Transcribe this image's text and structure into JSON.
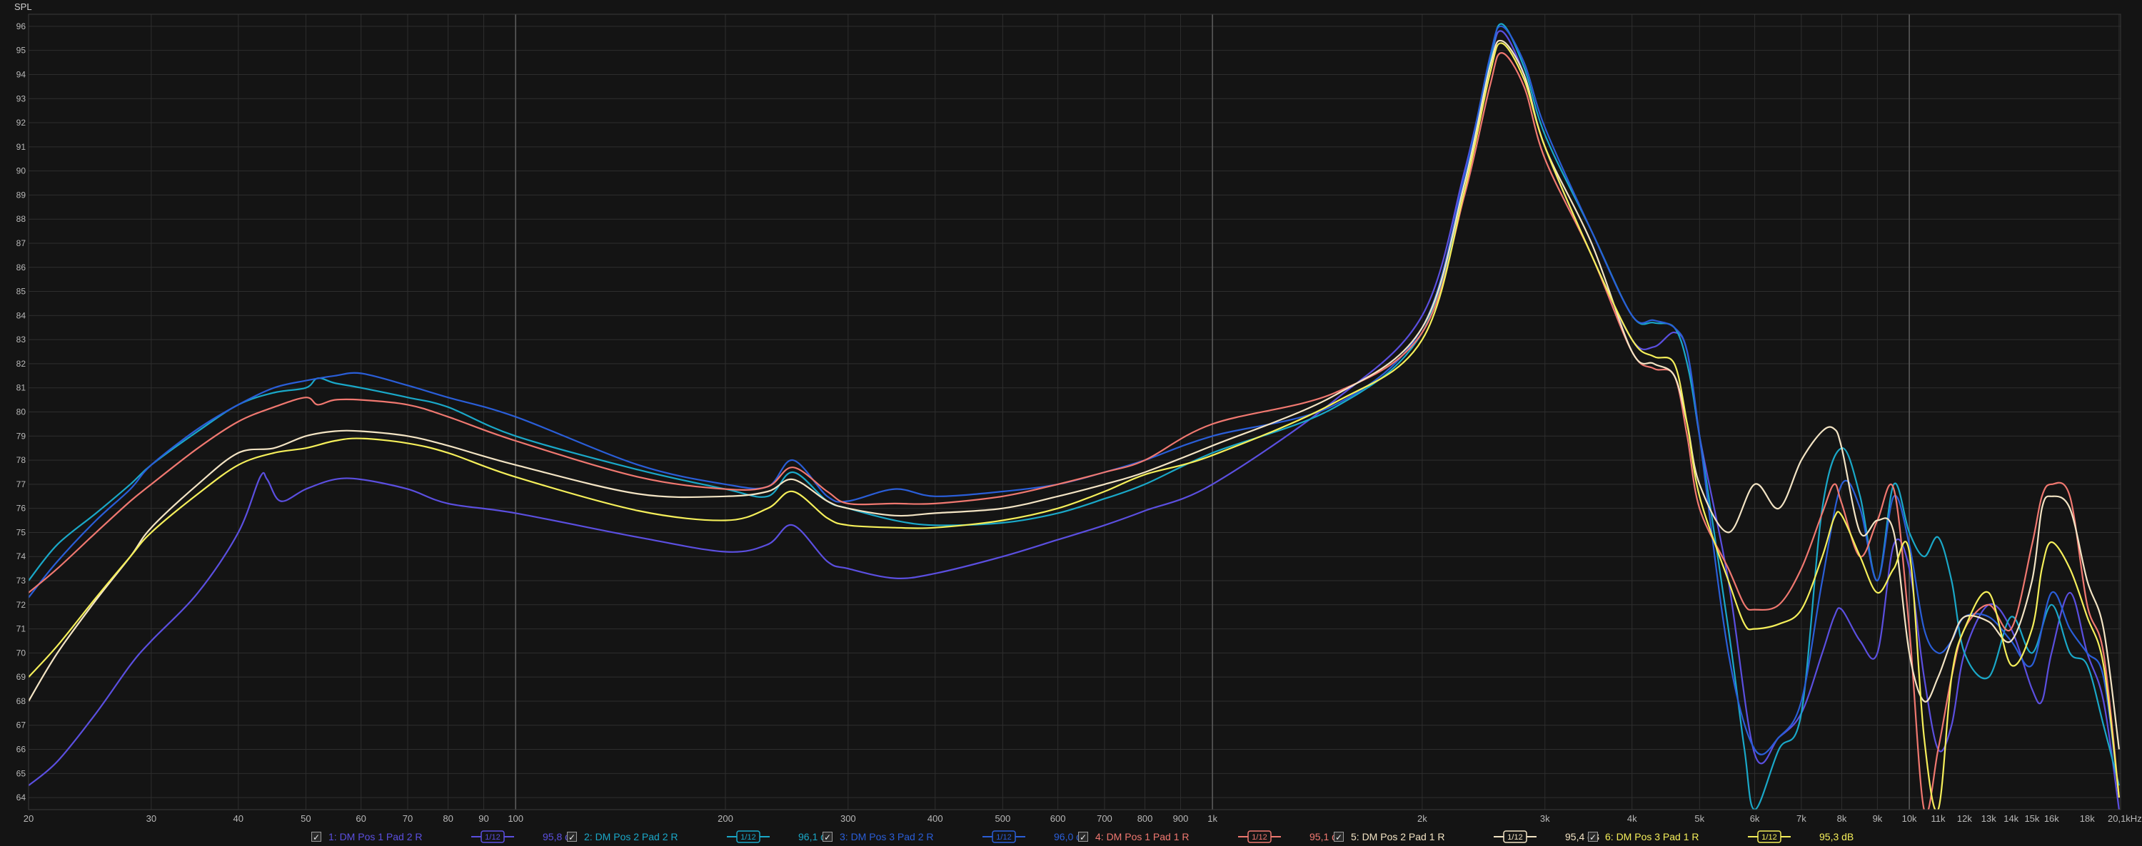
{
  "chart_data": {
    "type": "line",
    "ylabel": "SPL",
    "xlabel": "",
    "x_scale": "log",
    "xlim": [
      20,
      20100
    ],
    "ylim": [
      63.5,
      96.5
    ],
    "grid": true,
    "x_ticks": [
      {
        "v": 20,
        "t": "20"
      },
      {
        "v": 30,
        "t": "30"
      },
      {
        "v": 40,
        "t": "40"
      },
      {
        "v": 50,
        "t": "50"
      },
      {
        "v": 60,
        "t": "60"
      },
      {
        "v": 70,
        "t": "70"
      },
      {
        "v": 80,
        "t": "80"
      },
      {
        "v": 90,
        "t": "90"
      },
      {
        "v": 100,
        "t": "100"
      },
      {
        "v": 200,
        "t": "200"
      },
      {
        "v": 300,
        "t": "300"
      },
      {
        "v": 400,
        "t": "400"
      },
      {
        "v": 500,
        "t": "500"
      },
      {
        "v": 600,
        "t": "600"
      },
      {
        "v": 700,
        "t": "700"
      },
      {
        "v": 800,
        "t": "800"
      },
      {
        "v": 900,
        "t": "900"
      },
      {
        "v": 1000,
        "t": "1k"
      },
      {
        "v": 2000,
        "t": "2k"
      },
      {
        "v": 3000,
        "t": "3k"
      },
      {
        "v": 4000,
        "t": "4k"
      },
      {
        "v": 5000,
        "t": "5k"
      },
      {
        "v": 6000,
        "t": "6k"
      },
      {
        "v": 7000,
        "t": "7k"
      },
      {
        "v": 8000,
        "t": "8k"
      },
      {
        "v": 9000,
        "t": "9k"
      },
      {
        "v": 10000,
        "t": "10k"
      },
      {
        "v": 11000,
        "t": "11k"
      },
      {
        "v": 12000,
        "t": "12k"
      },
      {
        "v": 13000,
        "t": "13k"
      },
      {
        "v": 14000,
        "t": "14k"
      },
      {
        "v": 15000,
        "t": "15k"
      },
      {
        "v": 16000,
        "t": "16k"
      },
      {
        "v": 18000,
        "t": "18k"
      },
      {
        "v": 20100,
        "t": "20,1kHz"
      }
    ],
    "y_ticks": [
      64,
      65,
      66,
      67,
      68,
      69,
      70,
      71,
      72,
      73,
      74,
      75,
      76,
      77,
      78,
      79,
      80,
      81,
      82,
      83,
      84,
      85,
      86,
      87,
      88,
      89,
      90,
      91,
      92,
      93,
      94,
      95,
      96
    ],
    "series": [
      {
        "name": "1: DM Pos 1 Pad 2 R",
        "color": "#5b4fe0",
        "smoothing": "1/12",
        "value": "95,8 dB",
        "x": [
          20,
          22,
          25,
          28,
          30,
          35,
          40,
          43,
          44,
          46,
          50,
          55,
          60,
          70,
          80,
          100,
          150,
          200,
          230,
          250,
          280,
          300,
          350,
          400,
          500,
          600,
          700,
          800,
          1000,
          1500,
          2000,
          2300,
          2500,
          2600,
          2800,
          3000,
          3500,
          4000,
          4300,
          4600,
          4800,
          5000,
          5500,
          6000,
          6500,
          7000,
          7500,
          7800,
          8000,
          8500,
          9000,
          9500,
          10000,
          10500,
          11000,
          11500,
          12000,
          13000,
          14000,
          15000,
          15500,
          16000,
          17000,
          18000,
          19000,
          20000
        ],
        "y": [
          64.5,
          65.5,
          67.5,
          69.5,
          70.5,
          72.5,
          75,
          77.3,
          77.2,
          76.3,
          76.8,
          77.2,
          77.2,
          76.8,
          76.2,
          75.8,
          74.8,
          74.2,
          74.5,
          75.3,
          73.8,
          73.5,
          73.1,
          73.3,
          74,
          74.7,
          75.3,
          75.9,
          77,
          80.5,
          84,
          90,
          94.5,
          95.8,
          94,
          91,
          86.5,
          83,
          82.7,
          83.3,
          82.5,
          79,
          73,
          65.8,
          66.5,
          67.5,
          70,
          71.5,
          71.8,
          70.5,
          70,
          74.5,
          73.5,
          69,
          66,
          67,
          70,
          72,
          71,
          68.5,
          68,
          70,
          72.5,
          70,
          68,
          63.5
        ]
      },
      {
        "name": "2: DM Pos 2 Pad 2 R",
        "color": "#1aa8c8",
        "smoothing": "1/12",
        "value": "96,1 dB",
        "x": [
          20,
          22,
          25,
          28,
          30,
          35,
          40,
          45,
          50,
          52,
          55,
          60,
          70,
          80,
          100,
          150,
          200,
          230,
          250,
          280,
          300,
          350,
          400,
          500,
          600,
          700,
          800,
          1000,
          1500,
          2000,
          2300,
          2500,
          2600,
          2800,
          3000,
          3500,
          4000,
          4300,
          4600,
          4800,
          5000,
          5500,
          5800,
          6000,
          6500,
          7000,
          7500,
          8000,
          8500,
          9000,
          9500,
          10000,
          10500,
          11000,
          11500,
          12000,
          13000,
          14000,
          15000,
          16000,
          17000,
          18000,
          19000,
          20000
        ],
        "y": [
          73,
          74.5,
          75.8,
          77,
          77.8,
          79.2,
          80.3,
          80.8,
          81,
          81.4,
          81.2,
          81,
          80.6,
          80.2,
          79,
          77.6,
          76.8,
          76.5,
          77.5,
          76.3,
          76,
          75.5,
          75.3,
          75.4,
          75.8,
          76.4,
          77,
          78.3,
          80.2,
          83.3,
          89.5,
          94.5,
          96.1,
          94.3,
          91.5,
          87.5,
          84,
          83.7,
          83.5,
          82,
          79,
          71,
          66,
          63.5,
          66,
          67.5,
          76,
          78.5,
          76.5,
          73,
          77,
          75,
          74,
          74.8,
          73,
          70,
          69,
          71.5,
          70,
          72,
          70,
          69.5,
          67,
          64.5
        ]
      },
      {
        "name": "3: DM Pos 3 Pad 2 R",
        "color": "#2a5ed8",
        "smoothing": "1/12",
        "value": "96,0 dB",
        "x": [
          20,
          22,
          25,
          28,
          30,
          35,
          40,
          45,
          50,
          55,
          60,
          70,
          80,
          100,
          150,
          200,
          230,
          250,
          280,
          300,
          350,
          400,
          500,
          600,
          700,
          800,
          1000,
          1500,
          2000,
          2300,
          2500,
          2600,
          2800,
          3000,
          3500,
          4000,
          4300,
          4600,
          4800,
          5000,
          5500,
          6000,
          6500,
          7000,
          7500,
          8000,
          8500,
          9000,
          9500,
          10000,
          10500,
          11000,
          11500,
          12000,
          13000,
          14000,
          15000,
          16000,
          17000,
          18000,
          19000,
          20000
        ],
        "y": [
          72.3,
          73.8,
          75.5,
          76.8,
          77.8,
          79.3,
          80.3,
          81,
          81.3,
          81.5,
          81.6,
          81.1,
          80.6,
          79.8,
          77.8,
          77,
          76.9,
          78,
          76.5,
          76.3,
          76.8,
          76.5,
          76.7,
          77,
          77.5,
          78,
          79,
          80.3,
          83.5,
          89.8,
          94.7,
          96,
          94.5,
          91.8,
          87.5,
          84,
          83.8,
          83.5,
          82.5,
          79,
          70,
          66,
          66.5,
          68,
          73,
          77,
          76,
          73,
          76.5,
          74.5,
          71,
          70,
          70.5,
          71.5,
          71.5,
          70.5,
          69.5,
          72.5,
          71,
          70,
          69,
          64
        ]
      },
      {
        "name": "4: DM Pos 1 Pad 1 R",
        "color": "#f07870",
        "smoothing": "1/12",
        "value": "95,1 dB",
        "x": [
          20,
          22,
          25,
          28,
          30,
          35,
          40,
          45,
          50,
          52,
          55,
          60,
          70,
          80,
          100,
          150,
          200,
          230,
          250,
          280,
          300,
          350,
          400,
          500,
          600,
          700,
          800,
          1000,
          1500,
          2000,
          2300,
          2500,
          2600,
          2800,
          3000,
          3500,
          4000,
          4300,
          4600,
          4800,
          5000,
          5500,
          5800,
          6000,
          6500,
          7000,
          7500,
          7800,
          8000,
          8500,
          9000,
          9500,
          10000,
          10500,
          11000,
          11500,
          12000,
          13000,
          14000,
          15000,
          15500,
          16000,
          17000,
          18000,
          19000,
          20000
        ],
        "y": [
          72.5,
          73.5,
          75,
          76.3,
          77,
          78.5,
          79.6,
          80.2,
          80.6,
          80.3,
          80.5,
          80.5,
          80.3,
          79.8,
          78.8,
          77.3,
          76.8,
          76.9,
          77.7,
          76.7,
          76.2,
          76.2,
          76.2,
          76.5,
          77,
          77.5,
          78,
          79.5,
          80.8,
          83.3,
          89,
          93.5,
          94.9,
          93.5,
          90.5,
          86.5,
          82.5,
          81.8,
          81.5,
          79,
          76,
          73.5,
          72,
          71.8,
          72,
          73.5,
          75.8,
          77,
          76.2,
          74,
          75.5,
          76.8,
          71,
          63.5,
          66,
          69,
          71,
          72,
          71,
          74.5,
          76.5,
          77,
          76.5,
          72,
          70,
          64
        ]
      },
      {
        "name": "5: DM Pos 2 Pad 1 R",
        "color": "#f3e4c4",
        "smoothing": "1/12",
        "value": "95,4 dB",
        "x": [
          20,
          22,
          25,
          28,
          30,
          35,
          40,
          45,
          50,
          55,
          60,
          70,
          80,
          100,
          150,
          200,
          230,
          250,
          280,
          300,
          350,
          400,
          500,
          600,
          700,
          800,
          1000,
          1500,
          2000,
          2300,
          2500,
          2600,
          2800,
          3000,
          3500,
          4000,
          4300,
          4600,
          4800,
          5000,
          5500,
          6000,
          6500,
          7000,
          7500,
          7800,
          8000,
          8500,
          9000,
          9500,
          10000,
          10500,
          11000,
          11500,
          12000,
          13000,
          14000,
          15000,
          15500,
          16000,
          17000,
          18000,
          19000,
          20000
        ],
        "y": [
          68,
          70,
          72.2,
          74,
          75.2,
          77,
          78.3,
          78.5,
          79,
          79.2,
          79.2,
          79,
          78.6,
          77.8,
          76.6,
          76.5,
          76.7,
          77.2,
          76.3,
          76,
          75.7,
          75.8,
          76,
          76.5,
          77,
          77.5,
          78.6,
          80.7,
          83.5,
          89.5,
          94.3,
          95.4,
          94,
          91,
          87,
          82.5,
          82,
          81.5,
          79.5,
          77,
          75,
          77,
          76,
          78,
          79.2,
          79.3,
          78.5,
          75,
          75.5,
          75,
          70,
          68,
          69,
          70.5,
          71.5,
          71.3,
          70.5,
          73,
          76,
          76.5,
          76,
          73,
          71,
          66
        ]
      },
      {
        "name": "6: DM Pos 3 Pad 1 R",
        "color": "#f5ef5a",
        "smoothing": "1/12",
        "value": "95,3 dB",
        "x": [
          20,
          22,
          25,
          28,
          30,
          35,
          40,
          45,
          50,
          55,
          60,
          70,
          80,
          100,
          150,
          200,
          230,
          250,
          280,
          300,
          350,
          400,
          500,
          600,
          700,
          800,
          1000,
          1500,
          2000,
          2300,
          2500,
          2600,
          2800,
          3000,
          3500,
          4000,
          4300,
          4600,
          4800,
          5000,
          5500,
          5800,
          6000,
          6500,
          7000,
          7500,
          7800,
          8000,
          8500,
          9000,
          9500,
          10000,
          10500,
          11000,
          11500,
          12000,
          13000,
          14000,
          15000,
          15500,
          16000,
          17000,
          18000,
          19000,
          20000
        ],
        "y": [
          69,
          70.3,
          72.3,
          74,
          75,
          76.6,
          77.8,
          78.3,
          78.5,
          78.8,
          78.9,
          78.7,
          78.3,
          77.3,
          75.9,
          75.5,
          76,
          76.7,
          75.6,
          75.3,
          75.2,
          75.2,
          75.5,
          76,
          76.7,
          77.4,
          78.2,
          80.4,
          83,
          89.2,
          94,
          95.3,
          93.8,
          91,
          86.5,
          83,
          82.3,
          82,
          79.5,
          76.5,
          73,
          71.2,
          71,
          71.2,
          71.8,
          74,
          75.6,
          75.7,
          74,
          72.5,
          73.5,
          74.2,
          66.5,
          63.5,
          69,
          71,
          72.5,
          69.5,
          71,
          73.5,
          74.6,
          73.5,
          71.5,
          69.5,
          64
        ]
      }
    ]
  },
  "legend": {
    "items": [
      {
        "check": "✓"
      },
      {
        "check": "✓"
      },
      {
        "check": "✓"
      },
      {
        "check": "✓"
      },
      {
        "check": "✓"
      },
      {
        "check": "✓"
      }
    ]
  }
}
